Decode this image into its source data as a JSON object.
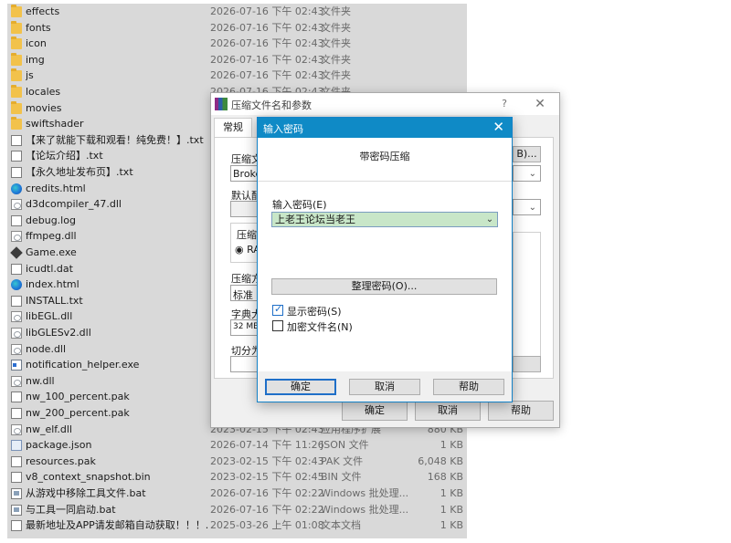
{
  "files": [
    {
      "icon": "folder-icon",
      "name": "effects",
      "date": "2026-07-16 下午 02:43",
      "type": "文件夹",
      "size": ""
    },
    {
      "icon": "folder-icon",
      "name": "fonts",
      "date": "2026-07-16 下午 02:43",
      "type": "文件夹",
      "size": ""
    },
    {
      "icon": "folder-icon",
      "name": "icon",
      "date": "2026-07-16 下午 02:43",
      "type": "文件夹",
      "size": ""
    },
    {
      "icon": "folder-icon",
      "name": "img",
      "date": "2026-07-16 下午 02:43",
      "type": "文件夹",
      "size": ""
    },
    {
      "icon": "folder-icon",
      "name": "js",
      "date": "2026-07-16 下午 02:43",
      "type": "文件夹",
      "size": ""
    },
    {
      "icon": "folder-icon",
      "name": "locales",
      "date": "2026-07-16 下午 02:43",
      "type": "文件夹",
      "size": ""
    },
    {
      "icon": "folder-icon",
      "name": "movies",
      "date": "",
      "type": "",
      "size": ""
    },
    {
      "icon": "folder-icon",
      "name": "swiftshader",
      "date": "",
      "type": "",
      "size": ""
    },
    {
      "icon": "text-file-icon",
      "name": "【来了就能下载和观看！纯免费！】.txt",
      "date": "",
      "type": "",
      "size": ""
    },
    {
      "icon": "text-file-icon",
      "name": "【论坛介绍】.txt",
      "date": "",
      "type": "",
      "size": ""
    },
    {
      "icon": "text-file-icon",
      "name": "【永久地址发布页】.txt",
      "date": "",
      "type": "",
      "size": ""
    },
    {
      "icon": "edge-icon",
      "name": "credits.html",
      "date": "",
      "type": "",
      "size": ""
    },
    {
      "icon": "dll-icon",
      "name": "d3dcompiler_47.dll",
      "date": "",
      "type": "",
      "size": ""
    },
    {
      "icon": "text-file-icon",
      "name": "debug.log",
      "date": "",
      "type": "",
      "size": ""
    },
    {
      "icon": "dll-icon",
      "name": "ffmpeg.dll",
      "date": "",
      "type": "",
      "size": ""
    },
    {
      "icon": "game-icon",
      "name": "Game.exe",
      "date": "",
      "type": "",
      "size": ""
    },
    {
      "icon": "text-file-icon",
      "name": "icudtl.dat",
      "date": "",
      "type": "",
      "size": ""
    },
    {
      "icon": "edge-icon",
      "name": "index.html",
      "date": "",
      "type": "",
      "size": ""
    },
    {
      "icon": "text-file-icon",
      "name": "INSTALL.txt",
      "date": "",
      "type": "",
      "size": ""
    },
    {
      "icon": "dll-icon",
      "name": "libEGL.dll",
      "date": "",
      "type": "",
      "size": ""
    },
    {
      "icon": "dll-icon",
      "name": "libGLESv2.dll",
      "date": "",
      "type": "",
      "size": ""
    },
    {
      "icon": "dll-icon",
      "name": "node.dll",
      "date": "",
      "type": "",
      "size": ""
    },
    {
      "icon": "exe-icon",
      "name": "notification_helper.exe",
      "date": "",
      "type": "",
      "size": ""
    },
    {
      "icon": "dll-icon",
      "name": "nw.dll",
      "date": "",
      "type": "",
      "size": ""
    },
    {
      "icon": "text-file-icon",
      "name": "nw_100_percent.pak",
      "date": "",
      "type": "",
      "size": ""
    },
    {
      "icon": "text-file-icon",
      "name": "nw_200_percent.pak",
      "date": "",
      "type": "",
      "size": ""
    },
    {
      "icon": "dll-icon",
      "name": "nw_elf.dll",
      "date": "2023-02-15 下午 02:43",
      "type": "应用程序扩展",
      "size": "880 KB"
    },
    {
      "icon": "json-file-icon",
      "name": "package.json",
      "date": "2026-07-14 下午 11:26",
      "type": "JSON 文件",
      "size": "1 KB"
    },
    {
      "icon": "text-file-icon",
      "name": "resources.pak",
      "date": "2023-02-15 下午 02:43",
      "type": "PAK 文件",
      "size": "6,048 KB"
    },
    {
      "icon": "text-file-icon",
      "name": "v8_context_snapshot.bin",
      "date": "2023-02-15 下午 02:45",
      "type": "BIN 文件",
      "size": "168 KB"
    },
    {
      "icon": "batch-file-icon",
      "name": "从游戏中移除工具文件.bat",
      "date": "2026-07-16 下午 02:22",
      "type": "Windows 批处理...",
      "size": "1 KB"
    },
    {
      "icon": "batch-file-icon",
      "name": "与工具一同启动.bat",
      "date": "2026-07-16 下午 02:22",
      "type": "Windows 批处理...",
      "size": "1 KB"
    },
    {
      "icon": "text-file-icon",
      "name": "最新地址及APP请发邮箱自动获取！！！....",
      "date": "2025-03-26 上午 01:08",
      "type": "文本文档",
      "size": "1 KB"
    }
  ],
  "archive_dialog": {
    "title": "压缩文件名和参数",
    "help": "?",
    "close": "✕",
    "tab_general": "常规",
    "lbl_archive_name": "压缩文",
    "archive_name_value": "Broker",
    "browse_button": "B)...",
    "lbl_default": "默认配",
    "lbl_format": "压缩",
    "format_radio": "RA",
    "lbl_method": "压缩方",
    "method_value": "标准",
    "lbl_dict": "字典大",
    "dict_value": "32 MB",
    "lbl_split": "切分为",
    "ok": "确定",
    "cancel": "取消",
    "help_btn": "帮助"
  },
  "password_dialog": {
    "title": "输入密码",
    "close": "✕",
    "header": "带密码压缩",
    "password_label": "输入密码(E)",
    "password_value": "上老王论坛当老王",
    "show_password": {
      "label": "显示密码(S)",
      "checked": true
    },
    "encrypt_names": {
      "label": "加密文件名(N)",
      "checked": false
    },
    "organize_button": "整理密码(O)...",
    "ok": "确定",
    "cancel": "取消",
    "help": "帮助"
  },
  "colors": {
    "accent": "#0f8ac6",
    "password_field": "#c8e6c8"
  }
}
